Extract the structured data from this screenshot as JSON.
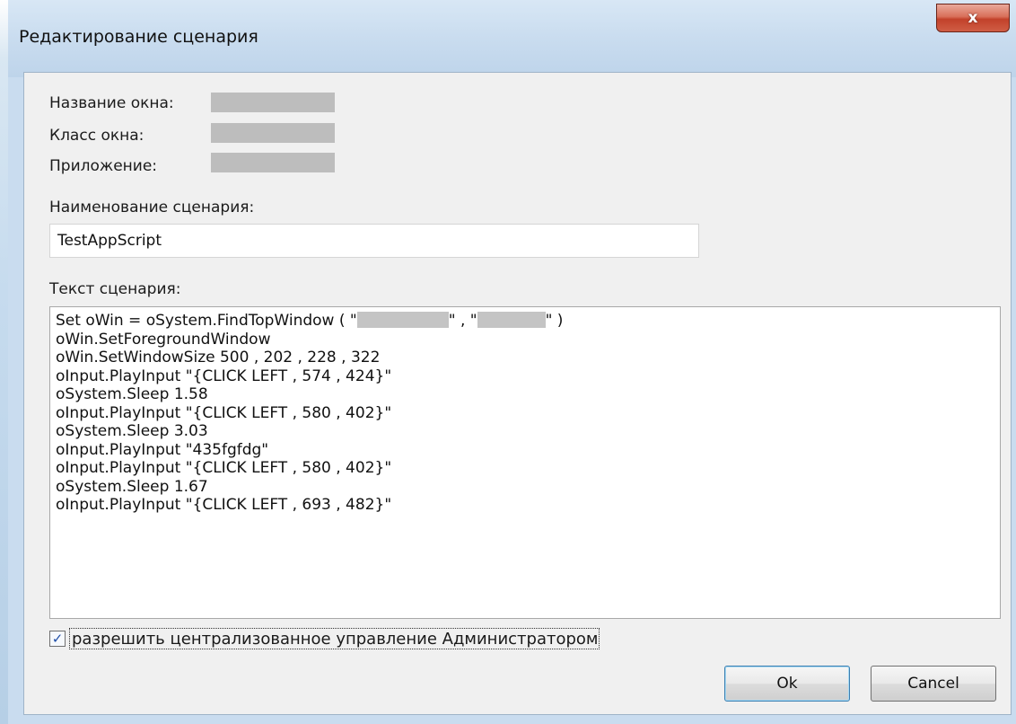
{
  "window": {
    "title": "Редактирование сценария",
    "close_glyph": "x"
  },
  "info": {
    "window_name_label": "Название окна:",
    "window_class_label": "Класс окна:",
    "application_label": "Приложение:"
  },
  "script_name": {
    "label": "Наименование сценария:",
    "value": "TestAppScript"
  },
  "script_text": {
    "label": "Текст сценария:",
    "first_line_prefix": "Set oWin = oSystem.FindTopWindow ( \"",
    "first_line_mid": "\" , \"",
    "first_line_suffix": "\" )",
    "lines": [
      "oWin.SetForegroundWindow",
      "oWin.SetWindowSize 500 , 202 , 228 , 322",
      "oInput.PlayInput \"{CLICK LEFT , 574 , 424}\"",
      "oSystem.Sleep 1.58",
      "oInput.PlayInput \"{CLICK LEFT , 580 , 402}\"",
      "oSystem.Sleep 3.03",
      "oInput.PlayInput \"435fgfdg\"",
      "oInput.PlayInput \"{CLICK LEFT , 580 , 402}\"",
      "oSystem.Sleep 1.67",
      "oInput.PlayInput \"{CLICK LEFT , 693 , 482}\""
    ]
  },
  "admin_control": {
    "checked": true,
    "label": "разрешить централизованное управление Администратором"
  },
  "buttons": {
    "ok": "Ok",
    "cancel": "Cancel"
  },
  "icons": {
    "close": "close-icon",
    "check": "checkmark-icon"
  }
}
